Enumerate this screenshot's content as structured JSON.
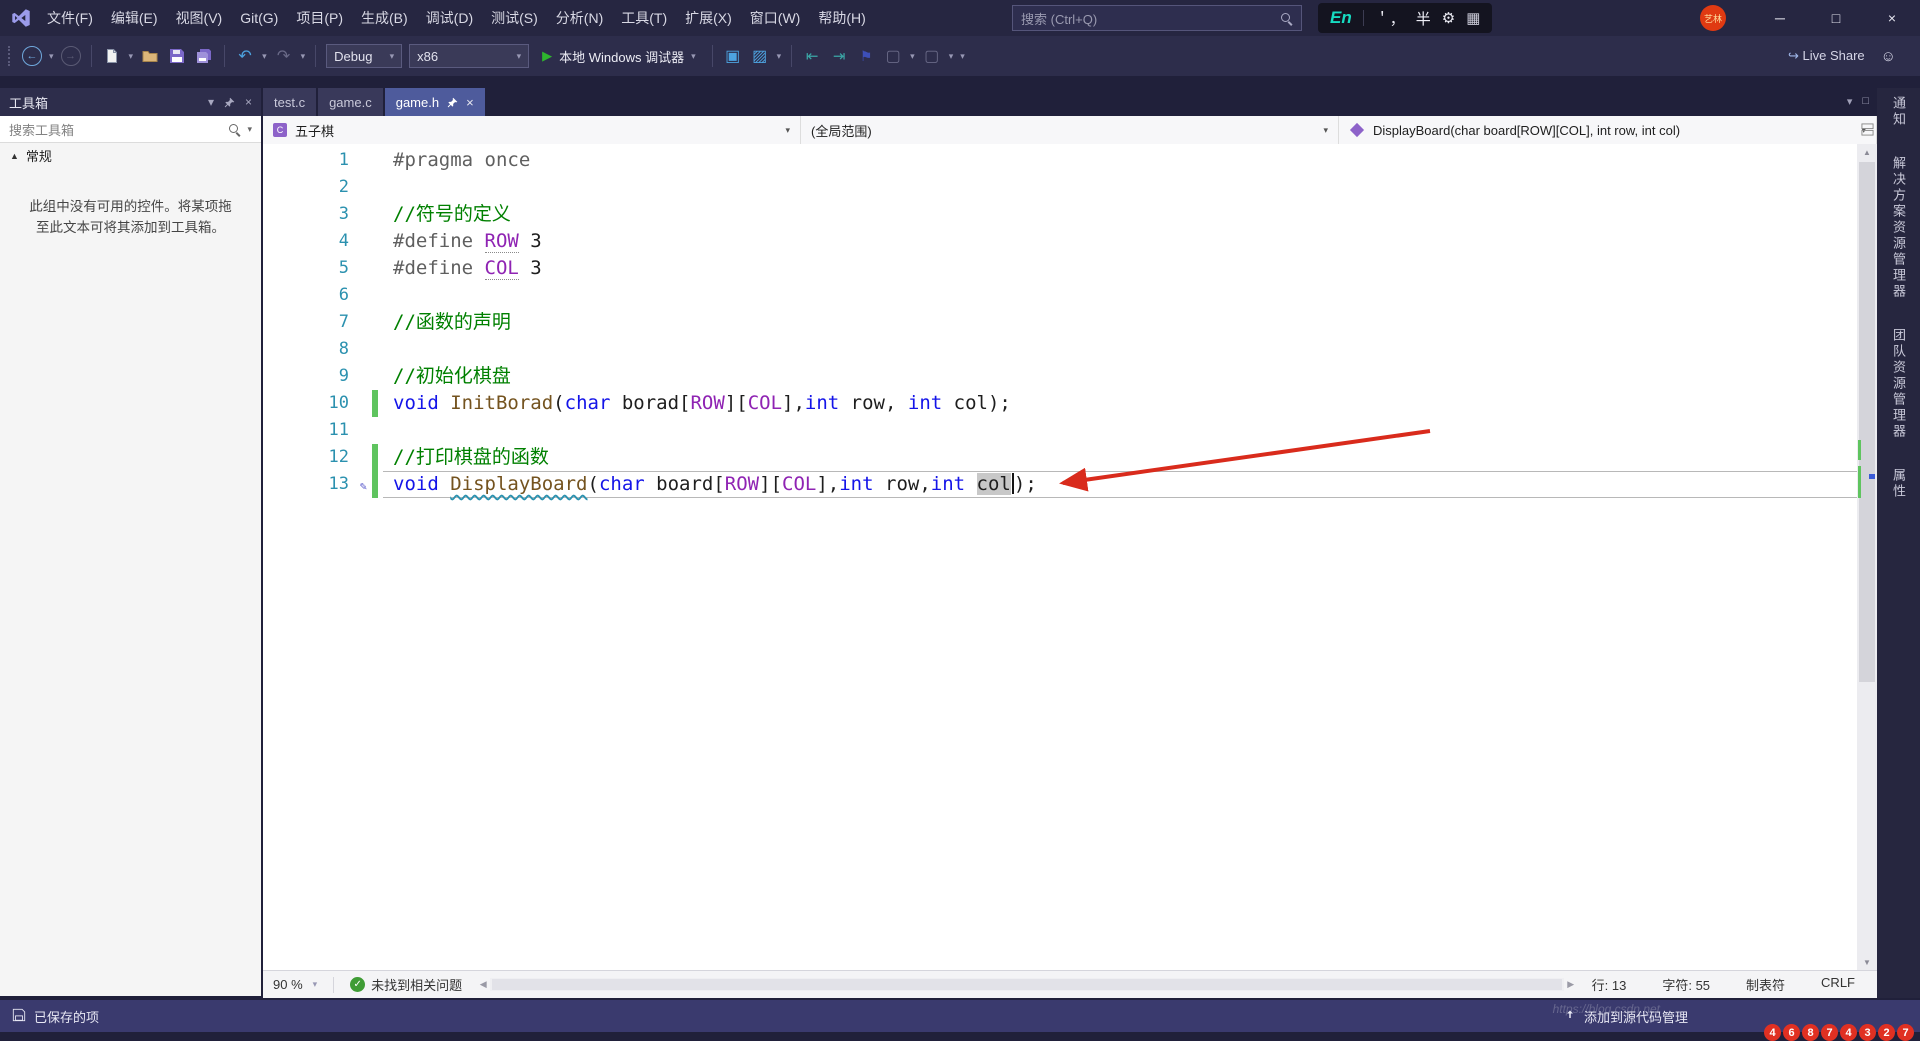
{
  "titlebar": {
    "menus": [
      "文件(F)",
      "编辑(E)",
      "视图(V)",
      "Git(G)",
      "项目(P)",
      "生成(B)",
      "调试(D)",
      "测试(S)",
      "分析(N)",
      "工具(T)",
      "扩展(X)",
      "窗口(W)",
      "帮助(H)"
    ],
    "search_placeholder": "搜索 (Ctrl+Q)",
    "ime": {
      "lang": "En",
      "punct": "＇，",
      "width": "半"
    },
    "avatar_text": "艺林",
    "window": {
      "minimize": "─",
      "maximize": "□",
      "close": "×"
    }
  },
  "toolbar": {
    "config": "Debug",
    "platform": "x86",
    "run": "本地 Windows 调试器",
    "live_share": "Live Share"
  },
  "toolbox": {
    "title": "工具箱",
    "search_placeholder": "搜索工具箱",
    "section": "常规",
    "empty_text": "此组中没有可用的控件。将某项拖至此文本可将其添加到工具箱。"
  },
  "tabs": [
    {
      "label": "test.c",
      "active": false,
      "pinned": false
    },
    {
      "label": "game.c",
      "active": false,
      "pinned": false
    },
    {
      "label": "game.h",
      "active": true,
      "pinned": true
    }
  ],
  "navbar": {
    "project": "五子棋",
    "scope": "(全局范围)",
    "member": "DisplayBoard(char board[ROW][COL], int row, int col)"
  },
  "editor": {
    "lines": [
      {
        "no": 1,
        "tokens": [
          {
            "t": "#pragma once",
            "c": "pp"
          }
        ]
      },
      {
        "no": 2,
        "tokens": []
      },
      {
        "no": 3,
        "tokens": [
          {
            "t": "//符号的定义",
            "c": "com"
          }
        ]
      },
      {
        "no": 4,
        "tokens": [
          {
            "t": "#define ",
            "c": "pp"
          },
          {
            "t": "ROW",
            "c": "macro",
            "u": true
          },
          {
            "t": " 3",
            "c": "plain"
          }
        ]
      },
      {
        "no": 5,
        "tokens": [
          {
            "t": "#define ",
            "c": "pp"
          },
          {
            "t": "COL",
            "c": "macro",
            "u": true
          },
          {
            "t": " 3",
            "c": "plain"
          }
        ]
      },
      {
        "no": 6,
        "tokens": []
      },
      {
        "no": 7,
        "tokens": [
          {
            "t": "//函数的声明",
            "c": "com"
          }
        ]
      },
      {
        "no": 8,
        "tokens": []
      },
      {
        "no": 9,
        "tokens": [
          {
            "t": "//初始化棋盘",
            "c": "com"
          }
        ]
      },
      {
        "no": 10,
        "changed": true,
        "tokens": [
          {
            "t": "void",
            "c": "kw"
          },
          {
            "t": " ",
            "c": "plain"
          },
          {
            "t": "InitBorad",
            "c": "fn"
          },
          {
            "t": "(",
            "c": "plain"
          },
          {
            "t": "char",
            "c": "kw"
          },
          {
            "t": " borad[",
            "c": "plain"
          },
          {
            "t": "ROW",
            "c": "macro"
          },
          {
            "t": "][",
            "c": "plain"
          },
          {
            "t": "COL",
            "c": "macro"
          },
          {
            "t": "],",
            "c": "plain"
          },
          {
            "t": "int",
            "c": "kw"
          },
          {
            "t": " row, ",
            "c": "plain"
          },
          {
            "t": "int",
            "c": "kw"
          },
          {
            "t": " col);",
            "c": "plain"
          }
        ]
      },
      {
        "no": 11,
        "tokens": []
      },
      {
        "no": 12,
        "changed": true,
        "tokens": [
          {
            "t": "//打印棋盘的函数",
            "c": "com"
          }
        ]
      },
      {
        "no": 13,
        "changed": true,
        "current": true,
        "pencil": true,
        "tokens": [
          {
            "t": "void",
            "c": "kw"
          },
          {
            "t": " ",
            "c": "plain"
          },
          {
            "t": "DisplayBoard",
            "c": "fn",
            "sq": true
          },
          {
            "t": "(",
            "c": "plain"
          },
          {
            "t": "char",
            "c": "kw"
          },
          {
            "t": " board[",
            "c": "plain"
          },
          {
            "t": "ROW",
            "c": "macro"
          },
          {
            "t": "][",
            "c": "plain"
          },
          {
            "t": "COL",
            "c": "macro"
          },
          {
            "t": "],",
            "c": "plain"
          },
          {
            "t": "int",
            "c": "kw"
          },
          {
            "t": " row,",
            "c": "plain"
          },
          {
            "t": "int",
            "c": "kw"
          },
          {
            "t": " ",
            "c": "plain"
          },
          {
            "t": "col",
            "c": "plain",
            "hl": true,
            "caretAfter": true
          },
          {
            "t": ");",
            "c": "plain"
          }
        ]
      }
    ]
  },
  "editor_status": {
    "zoom": "90 %",
    "problems": "未找到相关问题",
    "line": "行: 13",
    "column": "字符: 55",
    "tabs": "制表符",
    "eol": "CRLF"
  },
  "right_rail": {
    "tabs": [
      "通知",
      "解决方案资源管理器",
      "团队资源管理器",
      "属性"
    ]
  },
  "status_bar": {
    "saved": "已保存的项",
    "source_control": "添加到源代码管理",
    "watermark_url": "https://blog.csdn.net",
    "watermark_id": "46874327"
  },
  "colors": {
    "accent": "#4E5B9C",
    "arrow": "#D92B1C",
    "change_bar": "#5FC45F",
    "line_number": "#2B91AF"
  }
}
